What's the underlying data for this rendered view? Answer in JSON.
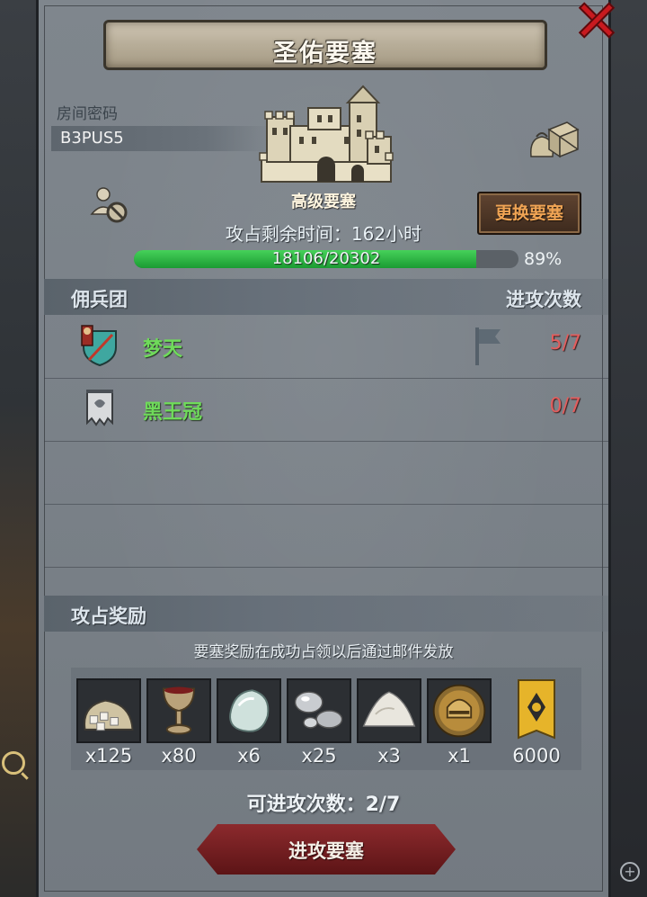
{
  "dialog": {
    "title": "圣佑要塞",
    "room_label": "房间密码",
    "room_code": "B3PUS5",
    "fortress_grade": "高级要塞",
    "time_remaining": "攻占剩余时间：162小时",
    "switch_button": "更换要塞",
    "progress": {
      "text": "18106/20302",
      "percent_text": "89%",
      "fraction": 0.89
    }
  },
  "mercenaries": {
    "header": "佣兵团",
    "attacks_header": "进攻次数",
    "rows": [
      {
        "name": "梦天",
        "count": "5/7"
      },
      {
        "name": "黑王冠",
        "count": "0/7"
      }
    ]
  },
  "rewards": {
    "header": "攻占奖励",
    "note": "要塞奖励在成功占领以后通过邮件发放",
    "items": [
      {
        "icon": "sack-icon",
        "qty": "x125"
      },
      {
        "icon": "goblet-icon",
        "qty": "x80"
      },
      {
        "icon": "gem-icon",
        "qty": "x6"
      },
      {
        "icon": "silver-ore-icon",
        "qty": "x25"
      },
      {
        "icon": "salt-pile-icon",
        "qty": "x3"
      },
      {
        "icon": "knight-helmet-icon",
        "qty": "x1"
      },
      {
        "icon": "guild-banner-icon",
        "qty": "6000"
      }
    ]
  },
  "attempts": "可进攻次数：2/7",
  "attack_button": "进攻要塞",
  "colors": {
    "progress": "#2fb545",
    "name": "#6fdb5a",
    "count": "#e35d5d",
    "button": "#7a2024"
  }
}
